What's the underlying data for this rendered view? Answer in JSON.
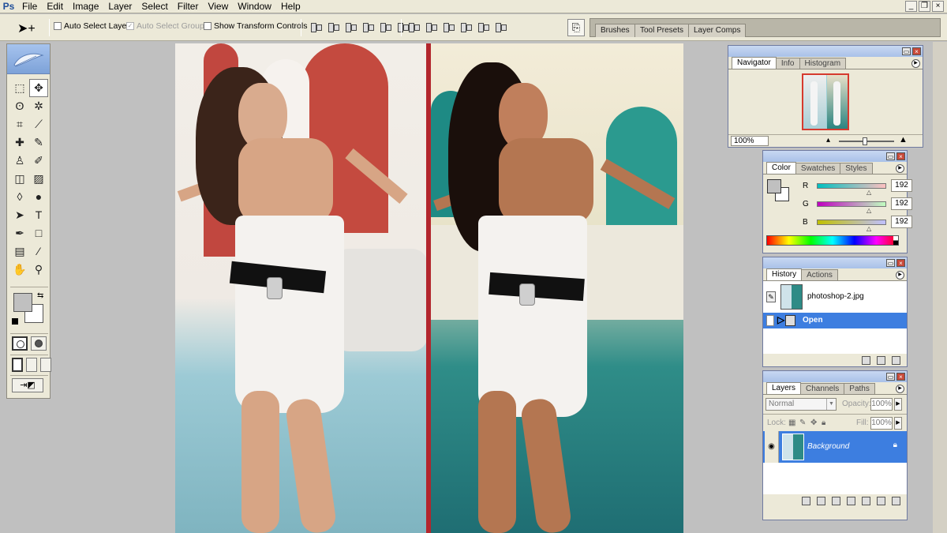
{
  "menu": {
    "items": [
      "File",
      "Edit",
      "Image",
      "Layer",
      "Select",
      "Filter",
      "View",
      "Window",
      "Help"
    ],
    "window_controls": [
      "_",
      "❐",
      "×"
    ]
  },
  "options_bar": {
    "auto_select_layer": "Auto Select Layer",
    "auto_select_groups": "Auto Select Groups",
    "show_transform_controls": "Show Transform Controls",
    "auto_select_groups_checked": true,
    "palette_well_tabs": [
      "Brushes",
      "Tool Presets",
      "Layer Comps"
    ]
  },
  "toolbox": {
    "tools": [
      {
        "name": "marquee-tool",
        "glyph": "⬚"
      },
      {
        "name": "move-tool",
        "glyph": "✥"
      },
      {
        "name": "lasso-tool",
        "glyph": "ʘ"
      },
      {
        "name": "magic-wand-tool",
        "glyph": "✲"
      },
      {
        "name": "crop-tool",
        "glyph": "⌗"
      },
      {
        "name": "slice-tool",
        "glyph": "⟋"
      },
      {
        "name": "healing-brush-tool",
        "glyph": "✚"
      },
      {
        "name": "brush-tool",
        "glyph": "✎"
      },
      {
        "name": "clone-stamp-tool",
        "glyph": "♙"
      },
      {
        "name": "history-brush-tool",
        "glyph": "✐"
      },
      {
        "name": "eraser-tool",
        "glyph": "◫"
      },
      {
        "name": "gradient-tool",
        "glyph": "▨"
      },
      {
        "name": "blur-tool",
        "glyph": "◊"
      },
      {
        "name": "dodge-tool",
        "glyph": "●"
      },
      {
        "name": "path-selection-tool",
        "glyph": "➤"
      },
      {
        "name": "type-tool",
        "glyph": "T"
      },
      {
        "name": "pen-tool",
        "glyph": "✒"
      },
      {
        "name": "shape-tool",
        "glyph": "□"
      },
      {
        "name": "notes-tool",
        "glyph": "▤"
      },
      {
        "name": "eyedropper-tool",
        "glyph": "⁄"
      },
      {
        "name": "hand-tool",
        "glyph": "✋"
      },
      {
        "name": "zoom-tool",
        "glyph": "⚲"
      }
    ],
    "foreground_color": "#c0c0c0",
    "background_color": "#ffffff"
  },
  "navigator": {
    "tabs": [
      "Navigator",
      "Info",
      "Histogram"
    ],
    "zoom": "100%"
  },
  "color_panel": {
    "tabs": [
      "Color",
      "Swatches",
      "Styles"
    ],
    "channels": [
      {
        "label": "R",
        "value": "192"
      },
      {
        "label": "G",
        "value": "192"
      },
      {
        "label": "B",
        "value": "192"
      }
    ]
  },
  "history_panel": {
    "tabs": [
      "History",
      "Actions"
    ],
    "snapshot": "photoshop-2.jpg",
    "steps": [
      "Open"
    ]
  },
  "layers_panel": {
    "tabs": [
      "Layers",
      "Channels",
      "Paths"
    ],
    "blend_mode": "Normal",
    "opacity_label": "Opacity:",
    "opacity": "100%",
    "lock_label": "Lock:",
    "fill_label": "Fill:",
    "fill": "100%",
    "layers": [
      {
        "name": "Background",
        "locked": true
      }
    ]
  },
  "colors": {
    "selection_blue": "#3d7ee0",
    "divider_red": "#b3262d",
    "panel_bg": "#ece9d8"
  }
}
